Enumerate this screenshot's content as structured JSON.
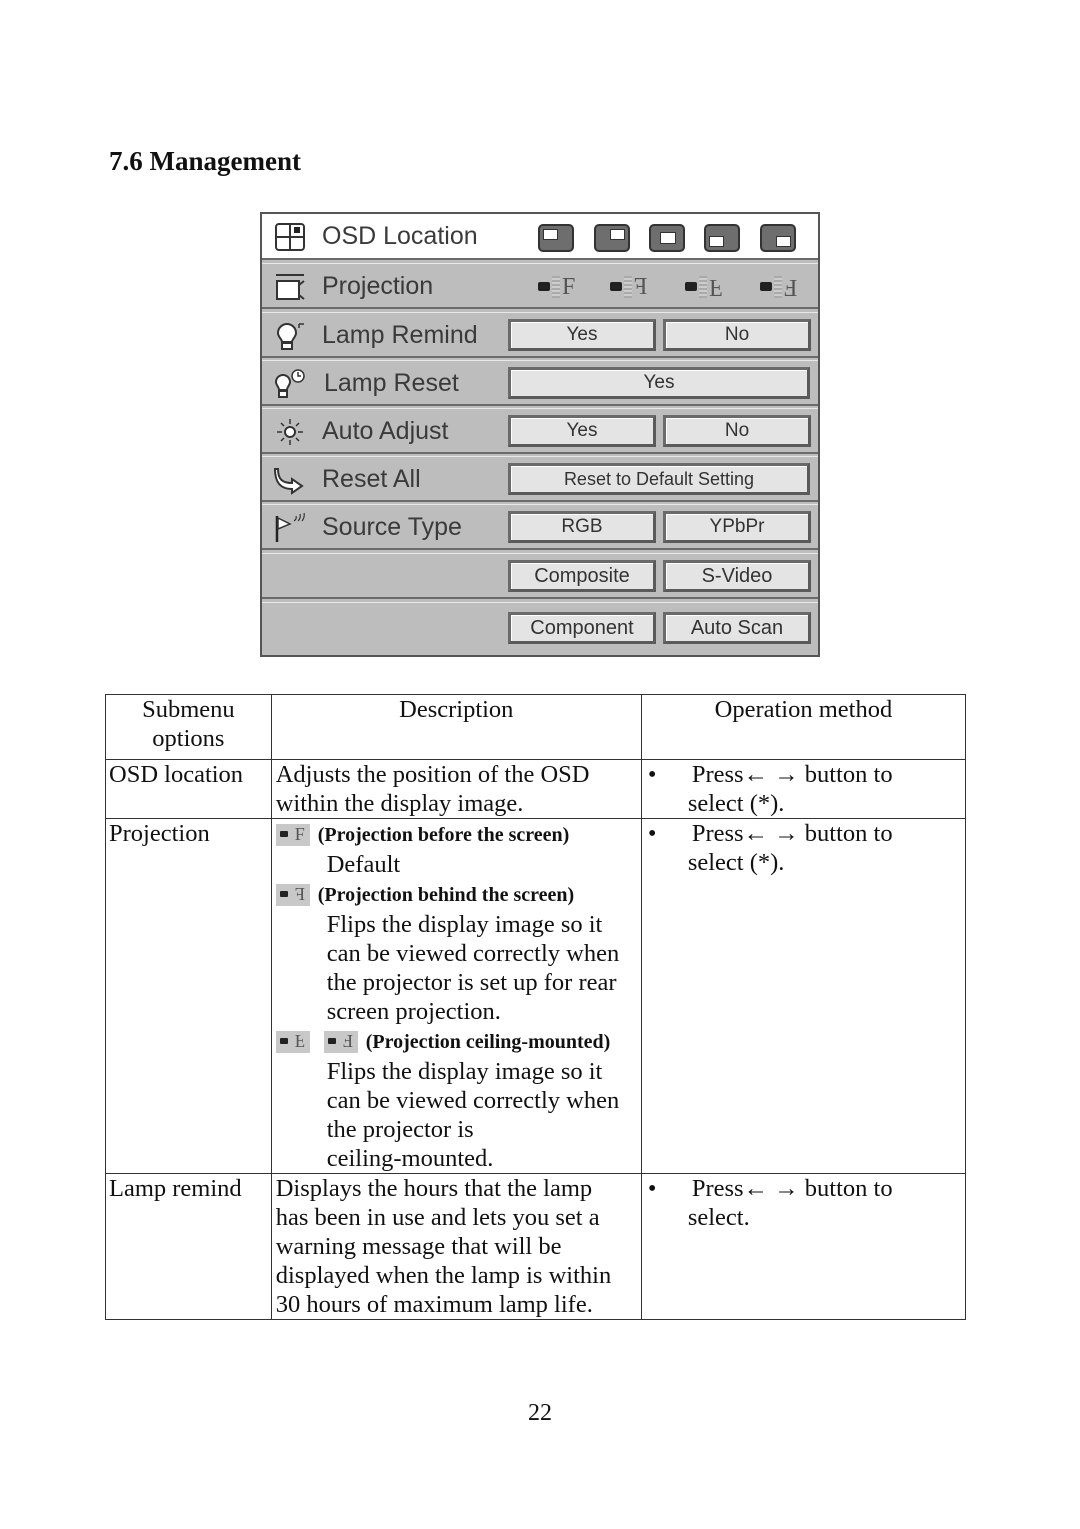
{
  "heading": "7.6 Management",
  "osd_menu": {
    "rows": [
      {
        "label": "OSD Location",
        "icon": "grid-icon",
        "options_type": "location-icons",
        "options": [
          "top-left",
          "top-right",
          "center",
          "bottom-left",
          "bottom-right"
        ]
      },
      {
        "label": "Projection",
        "icon": "projection-screen-icon",
        "options_type": "projection-icons",
        "options": [
          "F",
          "Ⅎ",
          "Ꮮ",
          "Ⅎ"
        ]
      },
      {
        "label": "Lamp Remind",
        "icon": "lamp-icon",
        "options": [
          "Yes",
          "No"
        ]
      },
      {
        "label": "Lamp Reset",
        "icon": "lamp-clock-icon",
        "options": [
          "Yes"
        ]
      },
      {
        "label": "Auto Adjust",
        "icon": "sun-icon",
        "options": [
          "Yes",
          "No"
        ]
      },
      {
        "label": "Reset All",
        "icon": "reset-arrow-icon",
        "options": [
          "Reset to Default Setting"
        ]
      },
      {
        "label": "Source Type",
        "icon": "signal-flag-icon",
        "options": [
          "RGB",
          "YPbPr"
        ]
      },
      {
        "label": "",
        "options": [
          "Composite",
          "S-Video"
        ]
      },
      {
        "label": "",
        "options": [
          "Component",
          "Auto Scan"
        ]
      }
    ]
  },
  "table": {
    "headers": [
      "Submenu options",
      "Description",
      "Operation method"
    ],
    "rows": [
      {
        "option": "OSD location",
        "description": "Adjusts the position of the OSD within the display image.",
        "operation": [
          "Press← → button to",
          "select (*)."
        ]
      },
      {
        "option": "Projection",
        "items": [
          {
            "title": "(Projection before the screen)",
            "text": "Default"
          },
          {
            "title": "(Projection behind the screen)",
            "text": [
              "Flips the display image so it",
              "can be viewed correctly when",
              "the projector is set up for rear",
              "screen projection."
            ]
          },
          {
            "title": "(Projection ceiling-mounted)",
            "text": [
              "Flips the display image so it",
              "can be viewed correctly when",
              "the projector is",
              "ceiling-mounted."
            ]
          }
        ],
        "operation": [
          "Press← → button to",
          "select (*)."
        ]
      },
      {
        "option": "Lamp remind",
        "description": [
          "Displays the hours that the lamp",
          "has been in use and lets you set a",
          "warning message that will be",
          "displayed when the lamp is within",
          "30 hours of maximum lamp life."
        ],
        "operation": [
          "Press← → button to",
          "select."
        ]
      }
    ]
  },
  "page_number": "22"
}
